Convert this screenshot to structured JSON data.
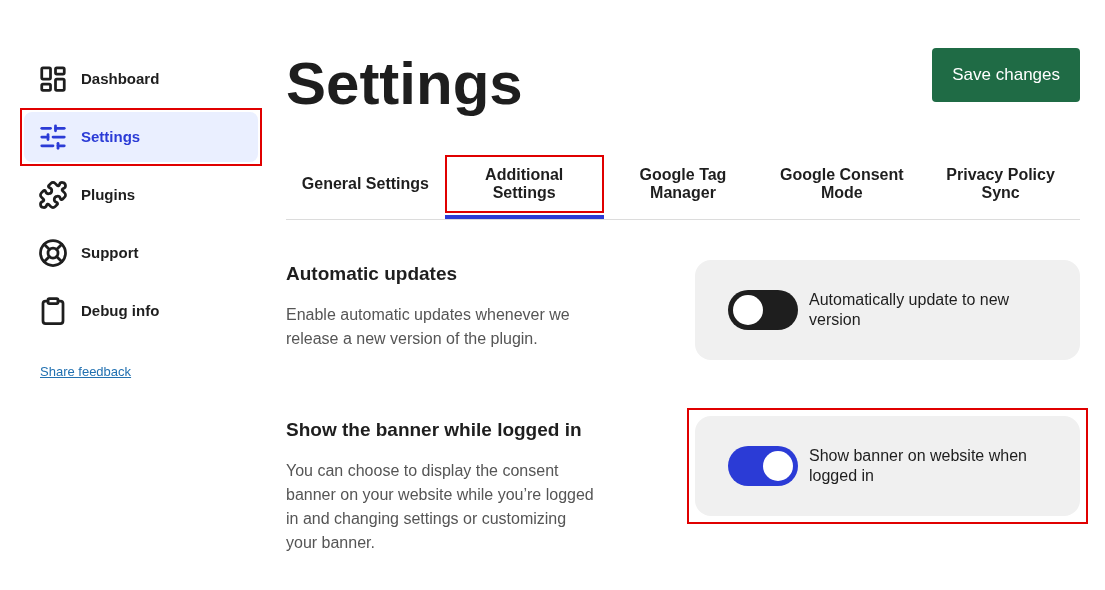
{
  "sidebar": {
    "items": [
      {
        "kind": "dashboard",
        "label": "Dashboard",
        "selected": false,
        "highlighted": false
      },
      {
        "kind": "settings",
        "label": "Settings",
        "selected": true,
        "highlighted": true
      },
      {
        "kind": "plugins",
        "label": "Plugins",
        "selected": false,
        "highlighted": false
      },
      {
        "kind": "support",
        "label": "Support",
        "selected": false,
        "highlighted": false
      },
      {
        "kind": "debug",
        "label": "Debug info",
        "selected": false,
        "highlighted": false
      }
    ],
    "feedback_link": "Share feedback"
  },
  "title": "Settings",
  "save_button": "Save changes",
  "tabs": [
    {
      "label": "General Settings",
      "selected": false,
      "highlighted": false
    },
    {
      "label": "Additional Settings",
      "selected": true,
      "highlighted": true
    },
    {
      "label": "Google Tag Manager",
      "selected": false,
      "highlighted": false
    },
    {
      "label": "Google Consent Mode",
      "selected": false,
      "highlighted": false
    },
    {
      "label": "Privacy Policy Sync",
      "selected": false,
      "highlighted": false
    }
  ],
  "sections": [
    {
      "heading": "Automatic updates",
      "description": "Enable automatic updates whenever we release a new version of the plugin.",
      "toggle_label": "Automatically update to new version",
      "on": false,
      "highlighted": false
    },
    {
      "heading": "Show the banner while logged in",
      "description": "You can choose to display the consent banner on your website while you’re logged in and changing settings or customizing your banner.",
      "toggle_label": "Show banner on website when logged in",
      "on": true,
      "highlighted": true
    }
  ]
}
